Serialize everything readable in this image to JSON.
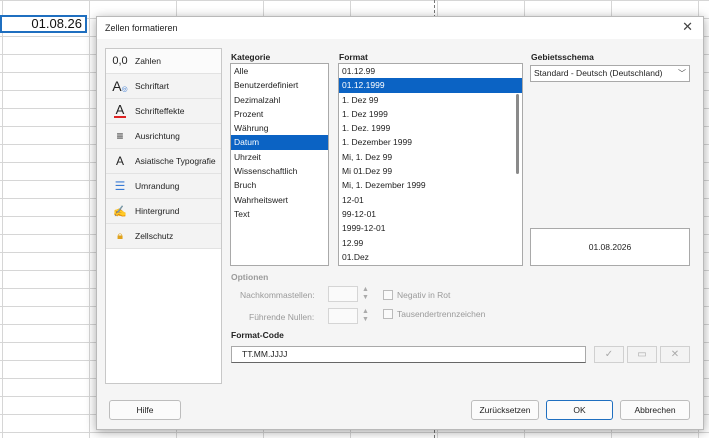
{
  "sheet": {
    "cell_value": "01.08.26"
  },
  "dialog": {
    "title": "Zellen formatieren",
    "close_glyph": "✕",
    "nav": [
      {
        "label": "Zahlen"
      },
      {
        "label": "Schriftart"
      },
      {
        "label": "Schrifteffekte"
      },
      {
        "label": "Ausrichtung"
      },
      {
        "label": "Asiatische Typografie"
      },
      {
        "label": "Umrandung"
      },
      {
        "label": "Hintergrund"
      },
      {
        "label": "Zellschutz"
      }
    ],
    "nav_selected": 0,
    "kategorie": {
      "label": "Kategorie",
      "items": [
        "Alle",
        "Benutzerdefiniert",
        "Dezimalzahl",
        "Prozent",
        "Währung",
        "Datum",
        "Uhrzeit",
        "Wissenschaftlich",
        "Bruch",
        "Wahrheitswert",
        "Text"
      ],
      "selected": 5
    },
    "format": {
      "label": "Format",
      "items": [
        "01.12.99",
        "01.12.1999",
        "1. Dez 99",
        "1. Dez 1999",
        "1. Dez. 1999",
        "1. Dezember 1999",
        "Mi, 1. Dez 99",
        "Mi 01.Dez 99",
        "Mi, 1. Dezember 1999",
        "12-01",
        "99-12-01",
        "1999-12-01",
        "12.99",
        "01.Dez"
      ],
      "selected": 1
    },
    "gebietsschema": {
      "label": "Gebietsschema",
      "value": "Standard - Deutsch (Deutschland)"
    },
    "preview": "01.08.2026",
    "optionen": {
      "label": "Optionen",
      "nachkommastellen": "Nachkommastellen:",
      "fuehrende_nullen": "Führende Nullen:",
      "negativ_rot": "Negativ in Rot",
      "tausender": "Tausendertrennzeichen"
    },
    "format_code": {
      "label": "Format-Code",
      "value": "TT.MM.JJJJ"
    },
    "buttons": {
      "help": "Hilfe",
      "reset": "Zurücksetzen",
      "ok": "OK",
      "cancel": "Abbrechen"
    }
  }
}
